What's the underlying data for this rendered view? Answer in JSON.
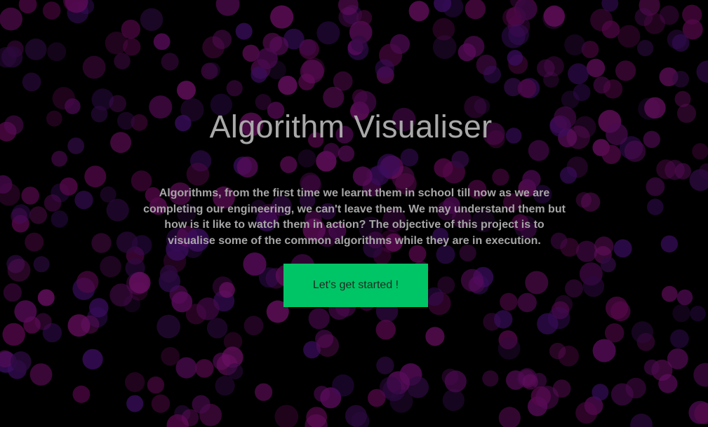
{
  "hero": {
    "title": "Algorithm Visualiser",
    "description": "Algorithms, from the first time we learnt them in school till now as we are completing our engineering, we can't leave them. We may understand them but how is it like to watch them in action? The objective of this project is to visualise some of the common algorithms while they are in execution.",
    "cta_label": "Let's get started !"
  },
  "colors": {
    "background": "#000000",
    "title_text": "#a9a9a9",
    "body_text": "#a6a6a6",
    "cta_background": "#00c566",
    "cta_text": "#1f2a23",
    "bokeh_palette": [
      "#4a0a4f",
      "#5a0c5c",
      "#3a0d5e",
      "#6a0f63",
      "#2d0a3f",
      "#55084a"
    ]
  }
}
